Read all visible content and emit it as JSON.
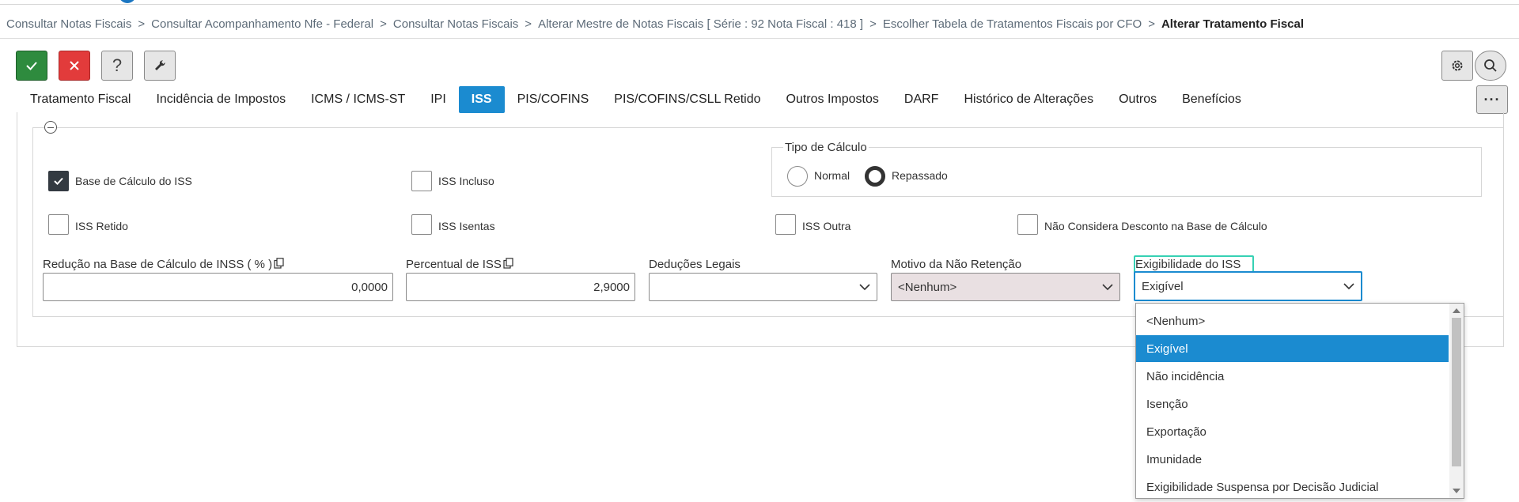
{
  "breadcrumb": [
    "Consultar Notas Fiscais",
    "Consultar Acompanhamento Nfe - Federal",
    "Consultar Notas Fiscais",
    "Alterar Mestre de Notas Fiscais [ Série : 92 Nota Fiscal : 418 ]",
    "Escolher Tabela de Tratamentos Fiscais por CFO",
    "Alterar Tratamento Fiscal"
  ],
  "breadcrumb_sep": ">",
  "toolbar": {
    "help_label": "?",
    "more_label": "···"
  },
  "tabs": [
    {
      "label": "Tratamento Fiscal"
    },
    {
      "label": "Incidência de Impostos"
    },
    {
      "label": "ICMS / ICMS-ST"
    },
    {
      "label": "IPI"
    },
    {
      "label": "ISS",
      "active": true
    },
    {
      "label": "PIS/COFINS"
    },
    {
      "label": "PIS/COFINS/CSLL Retido"
    },
    {
      "label": "Outros Impostos"
    },
    {
      "label": "DARF"
    },
    {
      "label": "Histórico de Alterações"
    },
    {
      "label": "Outros"
    },
    {
      "label": "Benefícios"
    }
  ],
  "checkboxes": {
    "base_calculo_iss": {
      "label": "Base de Cálculo do ISS",
      "checked": true
    },
    "iss_incluso": {
      "label": "ISS Incluso",
      "checked": false
    },
    "iss_retido": {
      "label": "ISS Retido",
      "checked": false
    },
    "iss_isentas": {
      "label": "ISS Isentas",
      "checked": false
    },
    "iss_outra": {
      "label": "ISS Outra",
      "checked": false
    },
    "nao_considera_desconto": {
      "label": "Não Considera Desconto na Base de Cálculo",
      "checked": false
    }
  },
  "tipo_calculo": {
    "legend": "Tipo de Cálculo",
    "options": [
      {
        "label": "Normal",
        "selected": false
      },
      {
        "label": "Repassado",
        "selected": true
      }
    ]
  },
  "fields": {
    "reducao_base": {
      "label": "Redução na Base de Cálculo de INSS ( % )",
      "value": "0,0000"
    },
    "percentual_iss": {
      "label": "Percentual de ISS",
      "value": "2,9000"
    },
    "deducoes_legais": {
      "label": "Deduções Legais",
      "value": ""
    },
    "motivo_nao_retencao": {
      "label": "Motivo da Não Retenção",
      "value": "<Nenhum>"
    },
    "exigibilidade_iss": {
      "label": "Exigibilidade do ISS",
      "value": "Exigível"
    }
  },
  "dropdown_options": [
    "<Nenhum>",
    "Exigível",
    "Não incidência",
    "Isenção",
    "Exportação",
    "Imunidade",
    "Exigibilidade Suspensa por Decisão Judicial"
  ],
  "dropdown_selected": "Exigível",
  "colors": {
    "accent": "#1b8bd0",
    "ok": "#2e8b3e",
    "cancel": "#e23b3b",
    "focus_ring": "#36d1b4"
  }
}
